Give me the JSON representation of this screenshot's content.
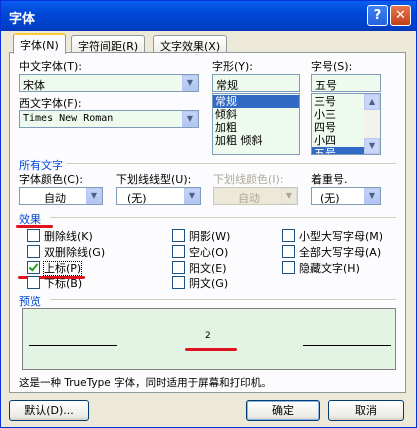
{
  "window": {
    "title": "字体",
    "help_glyph": "?",
    "close_glyph": "✕"
  },
  "tabs": [
    {
      "label": "字体(N)",
      "active": true
    },
    {
      "label": "字符间距(R)",
      "active": false
    },
    {
      "label": "文字效果(X)",
      "active": false
    }
  ],
  "font": {
    "chinese_label": "中文字体(T):",
    "chinese_value": "宋体",
    "western_label": "西文字体(F):",
    "western_value": "Times New Roman",
    "style_label": "字形(Y):",
    "style_value": "常规",
    "style_options": [
      "常规",
      "倾斜",
      "加粗",
      "加粗 倾斜"
    ],
    "style_selected": 0,
    "size_label": "字号(S):",
    "size_value": "五号",
    "size_options": [
      "三号",
      "小三",
      "四号",
      "小四",
      "五号"
    ],
    "size_selected": 4
  },
  "all_text": {
    "section_label": "所有文字",
    "color_label": "字体颜色(C):",
    "color_value": "自动",
    "underline_label": "下划线线型(U):",
    "underline_value": "(无)",
    "underline_color_label": "下划线颜色(I):",
    "underline_color_value": "自动",
    "emphasis_label": "着重号.",
    "emphasis_value": "(无)"
  },
  "effects": {
    "section_label": "效果",
    "items": [
      {
        "label": "删除线(K)",
        "checked": false
      },
      {
        "label": "双删除线(G)",
        "checked": false
      },
      {
        "label": "上标(P)",
        "checked": true
      },
      {
        "label": "下标(B)",
        "checked": false
      },
      {
        "label": "阴影(W)",
        "checked": false
      },
      {
        "label": "空心(O)",
        "checked": false
      },
      {
        "label": "阳文(E)",
        "checked": false
      },
      {
        "label": "阴文(G)",
        "checked": false
      },
      {
        "label": "小型大写字母(M)",
        "checked": false
      },
      {
        "label": "全部大写字母(A)",
        "checked": false
      },
      {
        "label": "隐藏文字(H)",
        "checked": false
      }
    ]
  },
  "preview": {
    "section_label": "预览",
    "sample": "2",
    "note": "这是一种 TrueType 字体，同时适用于屏幕和打印机。"
  },
  "buttons": {
    "default_label": "默认(D)...",
    "ok_label": "确定",
    "cancel_label": "取消"
  },
  "colors": {
    "title_bar": "#0047d7",
    "selection": "#316ac5",
    "annotation_red": "#e0141e",
    "field_green": "#eefaee"
  }
}
